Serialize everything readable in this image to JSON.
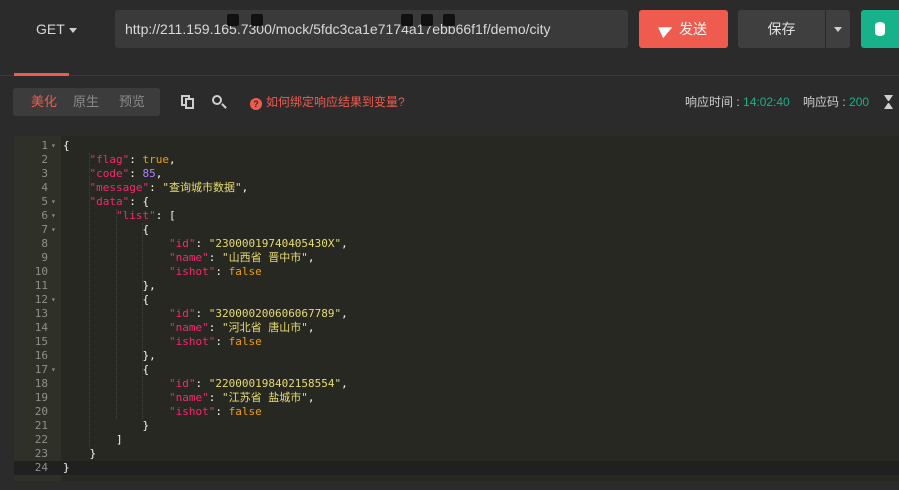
{
  "request": {
    "method": "GET",
    "url": "http://211.159.165.7300/mock/5fdc3ca1e7174a17ebb66f1f/demo/city",
    "send_label": "发送",
    "save_label": "保存"
  },
  "response_toolbar": {
    "view_modes": [
      "美化",
      "原生",
      "预览"
    ],
    "active_mode": "美化",
    "help_text": "如何绑定响应结果到变量?",
    "time_label": "响应时间 : ",
    "time_value": "14:02:40",
    "code_label": "响应码 : ",
    "code_value": "200"
  },
  "colors": {
    "accent_red": "#ef5b4f",
    "accent_green": "#18b28a",
    "editor_bg": "#272822"
  },
  "response_body": {
    "lines": [
      [
        {
          "t": "p",
          "v": "{"
        }
      ],
      [
        {
          "t": "p",
          "v": "    "
        },
        {
          "t": "k",
          "v": "\"flag\""
        },
        {
          "t": "p",
          "v": ": "
        },
        {
          "t": "b",
          "v": "true"
        },
        {
          "t": "p",
          "v": ","
        }
      ],
      [
        {
          "t": "p",
          "v": "    "
        },
        {
          "t": "k",
          "v": "\"code\""
        },
        {
          "t": "p",
          "v": ": "
        },
        {
          "t": "n",
          "v": "85"
        },
        {
          "t": "p",
          "v": ","
        }
      ],
      [
        {
          "t": "p",
          "v": "    "
        },
        {
          "t": "k",
          "v": "\"message\""
        },
        {
          "t": "p",
          "v": ": "
        },
        {
          "t": "s",
          "v": "\"查询城市数据\""
        },
        {
          "t": "p",
          "v": ","
        }
      ],
      [
        {
          "t": "p",
          "v": "    "
        },
        {
          "t": "k",
          "v": "\"data\""
        },
        {
          "t": "p",
          "v": ": {"
        }
      ],
      [
        {
          "t": "p",
          "v": "        "
        },
        {
          "t": "k",
          "v": "\"list\""
        },
        {
          "t": "p",
          "v": ": ["
        }
      ],
      [
        {
          "t": "p",
          "v": "            {"
        }
      ],
      [
        {
          "t": "p",
          "v": "                "
        },
        {
          "t": "k",
          "v": "\"id\""
        },
        {
          "t": "p",
          "v": ": "
        },
        {
          "t": "s",
          "v": "\"23000019740405430X\""
        },
        {
          "t": "p",
          "v": ","
        }
      ],
      [
        {
          "t": "p",
          "v": "                "
        },
        {
          "t": "k",
          "v": "\"name\""
        },
        {
          "t": "p",
          "v": ": "
        },
        {
          "t": "s",
          "v": "\"山西省 晋中市\""
        },
        {
          "t": "p",
          "v": ","
        }
      ],
      [
        {
          "t": "p",
          "v": "                "
        },
        {
          "t": "k",
          "v": "\"ishot\""
        },
        {
          "t": "p",
          "v": ": "
        },
        {
          "t": "b",
          "v": "false"
        }
      ],
      [
        {
          "t": "p",
          "v": "            },"
        }
      ],
      [
        {
          "t": "p",
          "v": "            {"
        }
      ],
      [
        {
          "t": "p",
          "v": "                "
        },
        {
          "t": "k",
          "v": "\"id\""
        },
        {
          "t": "p",
          "v": ": "
        },
        {
          "t": "s",
          "v": "\"320000200606067789\""
        },
        {
          "t": "p",
          "v": ","
        }
      ],
      [
        {
          "t": "p",
          "v": "                "
        },
        {
          "t": "k",
          "v": "\"name\""
        },
        {
          "t": "p",
          "v": ": "
        },
        {
          "t": "s",
          "v": "\"河北省 唐山市\""
        },
        {
          "t": "p",
          "v": ","
        }
      ],
      [
        {
          "t": "p",
          "v": "                "
        },
        {
          "t": "k",
          "v": "\"ishot\""
        },
        {
          "t": "p",
          "v": ": "
        },
        {
          "t": "b",
          "v": "false"
        }
      ],
      [
        {
          "t": "p",
          "v": "            },"
        }
      ],
      [
        {
          "t": "p",
          "v": "            {"
        }
      ],
      [
        {
          "t": "p",
          "v": "                "
        },
        {
          "t": "k",
          "v": "\"id\""
        },
        {
          "t": "p",
          "v": ": "
        },
        {
          "t": "s",
          "v": "\"220000198402158554\""
        },
        {
          "t": "p",
          "v": ","
        }
      ],
      [
        {
          "t": "p",
          "v": "                "
        },
        {
          "t": "k",
          "v": "\"name\""
        },
        {
          "t": "p",
          "v": ": "
        },
        {
          "t": "s",
          "v": "\"江苏省 盐城市\""
        },
        {
          "t": "p",
          "v": ","
        }
      ],
      [
        {
          "t": "p",
          "v": "                "
        },
        {
          "t": "k",
          "v": "\"ishot\""
        },
        {
          "t": "p",
          "v": ": "
        },
        {
          "t": "b",
          "v": "false"
        }
      ],
      [
        {
          "t": "p",
          "v": "            }"
        }
      ],
      [
        {
          "t": "p",
          "v": "        ]"
        }
      ],
      [
        {
          "t": "p",
          "v": "    }"
        }
      ],
      [
        {
          "t": "p",
          "v": "}"
        }
      ]
    ],
    "foldable_lines": [
      1,
      5,
      6,
      7,
      12,
      17
    ]
  }
}
